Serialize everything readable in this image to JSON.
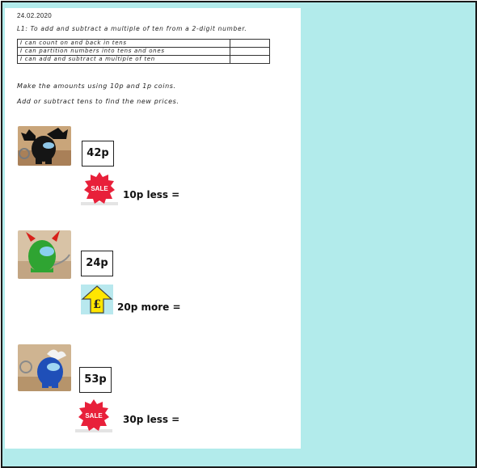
{
  "header": {
    "date": "24.02.2020",
    "objective": "L1: To add and subtract a multiple of ten from a 2-digit number."
  },
  "success_criteria": [
    "I can count on and back in tens",
    "I can partition numbers into tens and ones",
    "I can add and subtract a multiple of ten"
  ],
  "instructions": [
    "Make the amounts using 10p and 1p coins.",
    "Add or subtract tens to find the new prices."
  ],
  "items": [
    {
      "price": "42p",
      "question": "10p less =",
      "badge": "SALE",
      "photo_icon": "black-bat-toy-icon"
    },
    {
      "price": "24p",
      "question": "20p more =",
      "badge": "£",
      "photo_icon": "green-devil-toy-icon"
    },
    {
      "price": "53p",
      "question": "30p less =",
      "badge": "SALE",
      "photo_icon": "blue-horned-toy-icon"
    }
  ],
  "colors": {
    "background": "#b2ebeb",
    "sale_red": "#e8203a",
    "arrow_yellow": "#ffe600"
  }
}
